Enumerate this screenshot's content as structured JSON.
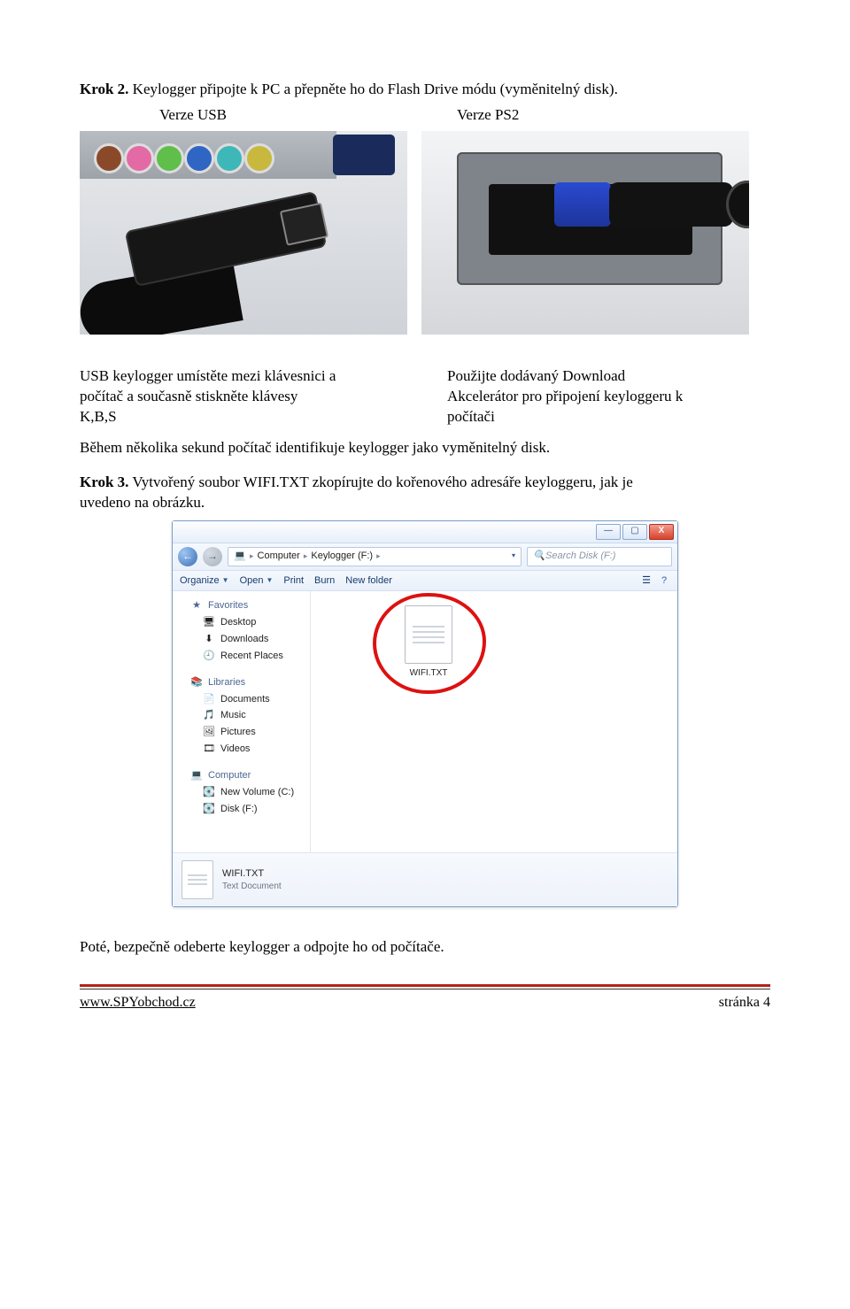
{
  "step2": {
    "label": "Krok 2.",
    "text": "Keylogger připojte k PC a přepněte ho do Flash Drive módu (vyměnitelný disk)."
  },
  "versions": {
    "usb": "Verze USB",
    "ps2": "Verze PS2"
  },
  "col_left": {
    "l1": "USB keylogger umístěte mezi klávesnici a",
    "l2": "počítač a současně stiskněte klávesy",
    "l3": "K,B,S"
  },
  "col_right": {
    "l1": "Použijte dodávaný Download",
    "l2": "Akcelerátor pro připojení keyloggeru k",
    "l3": "počítači"
  },
  "identify": "Během několika sekund počítač identifikuje keylogger jako vyměnitelný disk.",
  "step3": {
    "label": "Krok 3.",
    "text_before": "Vytvořený soubor WIFI.TXT zkopírujte do kořenového adresáře keyloggeru, jak je",
    "text_after": "uvedeno na obrázku."
  },
  "explorer": {
    "win": {
      "min": "—",
      "max": "▢",
      "close": "X"
    },
    "crumbs": {
      "c1": "Computer",
      "c2": "Keylogger (F:)",
      "sep": "▸",
      "dd": "▾"
    },
    "search_placeholder": "Search Disk (F:)",
    "toolbar": {
      "organize": "Organize",
      "open": "Open",
      "print": "Print",
      "burn": "Burn",
      "newfolder": "New folder"
    },
    "sidebar": {
      "favorites": "Favorites",
      "desktop": "Desktop",
      "downloads": "Downloads",
      "recent": "Recent Places",
      "libraries": "Libraries",
      "documents": "Documents",
      "music": "Music",
      "pictures": "Pictures",
      "videos": "Videos",
      "computer": "Computer",
      "volc": "New Volume (C:)",
      "diskf": "Disk (F:)"
    },
    "file": {
      "name": "WIFI.TXT"
    },
    "details": {
      "name": "WIFI.TXT",
      "type": "Text Document"
    }
  },
  "after_img": "Poté, bezpečně odeberte keylogger a odpojte ho od počítače.",
  "footer": {
    "site": "www.SPYobchod.cz",
    "page": "stránka 4"
  }
}
